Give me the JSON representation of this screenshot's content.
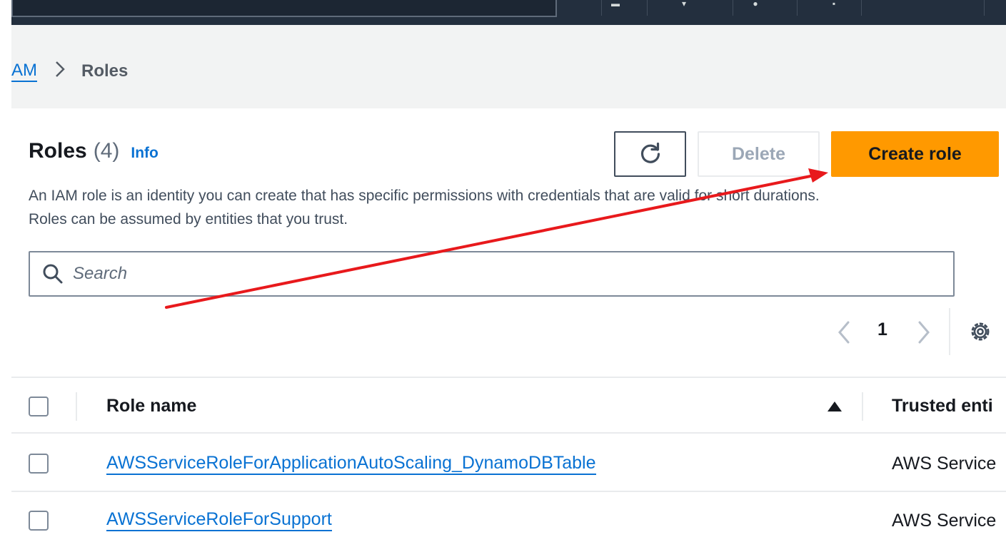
{
  "breadcrumb": {
    "parent": "AM",
    "separator": ">",
    "current": "Roles"
  },
  "header": {
    "title": "Roles",
    "count": "(4)",
    "info": "Info",
    "description_line1": "An IAM role is an identity you can create that has specific permissions with credentials that are valid for short durations.",
    "description_line2": "Roles can be assumed by entities that you trust."
  },
  "actions": {
    "refresh_icon": "refresh-icon",
    "delete_label": "Delete",
    "create_label": "Create role"
  },
  "search": {
    "placeholder": "Search"
  },
  "pagination": {
    "current_page": "1"
  },
  "table": {
    "columns": [
      "Role name",
      "Trusted enti"
    ],
    "rows": [
      {
        "role_name": "AWSServiceRoleForApplicationAutoScaling_DynamoDBTable",
        "trusted": "AWS Service"
      },
      {
        "role_name": "AWSServiceRoleForSupport",
        "trusted": "AWS Service"
      }
    ]
  },
  "colors": {
    "primary_button": "#ff9900",
    "link": "#0972d3",
    "annotation_arrow": "#e8191c",
    "topbar": "#232f3e"
  }
}
